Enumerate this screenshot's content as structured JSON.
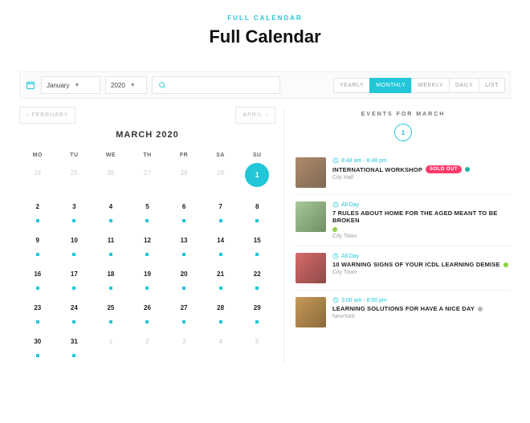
{
  "header": {
    "eyebrow": "FULL CALENDAR",
    "title": "Full Calendar"
  },
  "toolbar": {
    "month_select": "January",
    "year_select": "2020",
    "search_value": "",
    "views": [
      "YEARLY",
      "MONTHLY",
      "WEEKLY",
      "DAILY",
      "LIST"
    ],
    "active_view": "MONTHLY"
  },
  "calendar": {
    "prev_label": "FEBRUARY",
    "next_label": "APRIL",
    "month_title": "MARCH 2020",
    "dow": [
      "MO",
      "TU",
      "WE",
      "TH",
      "FR",
      "SA",
      "SU"
    ],
    "cells": [
      {
        "n": 24,
        "out": true
      },
      {
        "n": 25,
        "out": true
      },
      {
        "n": 26,
        "out": true
      },
      {
        "n": 27,
        "out": true
      },
      {
        "n": 28,
        "out": true
      },
      {
        "n": 29,
        "out": true
      },
      {
        "n": 1,
        "sel": true
      },
      {
        "n": 2,
        "dot": true
      },
      {
        "n": 3,
        "dot": true
      },
      {
        "n": 4,
        "dot": true
      },
      {
        "n": 5,
        "dot": true
      },
      {
        "n": 6,
        "dot": true
      },
      {
        "n": 7,
        "dot": true
      },
      {
        "n": 8,
        "dot": true
      },
      {
        "n": 9,
        "dot": true
      },
      {
        "n": 10,
        "dot": true
      },
      {
        "n": 11,
        "dot": true
      },
      {
        "n": 12,
        "dot": true
      },
      {
        "n": 13,
        "dot": true
      },
      {
        "n": 14,
        "dot": true
      },
      {
        "n": 15,
        "dot": true
      },
      {
        "n": 16,
        "dot": true
      },
      {
        "n": 17,
        "dot": true
      },
      {
        "n": 18,
        "dot": true
      },
      {
        "n": 19,
        "dot": true
      },
      {
        "n": 20,
        "dot": true
      },
      {
        "n": 21,
        "dot": true
      },
      {
        "n": 22,
        "dot": true
      },
      {
        "n": 23,
        "dot": true
      },
      {
        "n": 24,
        "dot": true
      },
      {
        "n": 25,
        "dot": true
      },
      {
        "n": 26,
        "dot": true
      },
      {
        "n": 27,
        "dot": true
      },
      {
        "n": 28,
        "dot": true
      },
      {
        "n": 29,
        "dot": true
      },
      {
        "n": 30,
        "dot": true
      },
      {
        "n": 31,
        "dot": true
      },
      {
        "n": 1,
        "out": true
      },
      {
        "n": 2,
        "out": true
      },
      {
        "n": 3,
        "out": true
      },
      {
        "n": 4,
        "out": true
      },
      {
        "n": 5,
        "out": true
      }
    ]
  },
  "events_panel": {
    "heading": "EVENTS FOR MARCH",
    "day": "1",
    "items": [
      {
        "time": "8:48 am - 8:48 pm",
        "title": "INTERNATIONAL WORKSHOP",
        "badge": "SOLD OUT",
        "status": "teal",
        "location": "City Hall",
        "thumb": "t1"
      },
      {
        "time": "All Day",
        "title": "7 RULES ABOUT HOME FOR THE AGED MEANT TO BE BROKEN",
        "status": "green",
        "location": "City Town",
        "thumb": "t2"
      },
      {
        "time": "All Day",
        "title": "10 WARNING SIGNS OF YOUR ICDL LEARNING DEMISE",
        "status": "green",
        "location": "City Town",
        "thumb": "t3"
      },
      {
        "time": "3:00 am - 8:00 pm",
        "title": "LEARNING SOLUTIONS FOR HAVE A NICE DAY",
        "status": "grey",
        "location": "NewYork",
        "thumb": "t4"
      }
    ]
  }
}
